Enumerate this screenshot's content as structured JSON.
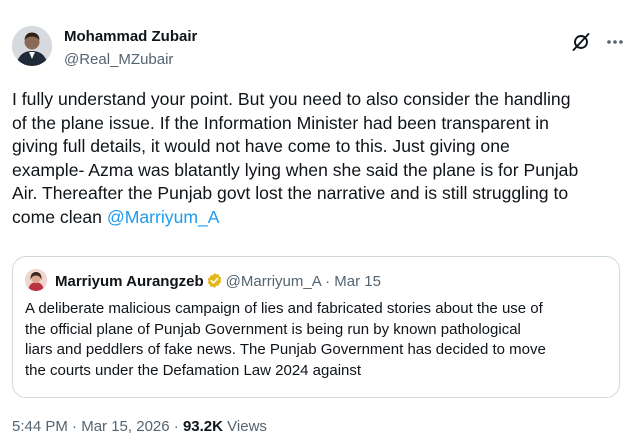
{
  "tweet": {
    "author_name": "Mohammad Zubair",
    "author_handle": "@Real_MZubair",
    "text": "I fully understand your point. But you need to also consider the handling\nof the plane issue. If the Information Minister had been transparent in\ngiving full details, it would not have come to this. Just giving one\nexample- Azma was blatantly lying when she said the plane is for Punjab\nAir. Thereafter the Punjab govt lost the narrative and is still struggling to\ncome clean ",
    "mention": "@Marriyum_A",
    "icons": {
      "grok": "grok-icon",
      "more": "more-icon",
      "verified": "verified-badge-icon"
    },
    "colors": {
      "link": "#1d9bf0",
      "verified_gold": "#e2b719",
      "muted": "#536471",
      "border": "#cfd9de"
    }
  },
  "quote": {
    "author_name": "Marriyum Aurangzeb",
    "handle": "@Marriyum_A",
    "separator": "·",
    "date": "Mar 15",
    "text": "A deliberate malicious campaign of lies and fabricated stories about the use of\nthe official plane of Punjab Government is being run by known pathological\nliars and  peddlers of fake news. The Punjab Government has decided to move\nthe courts under the Defamation Law 2024 against"
  },
  "footer": {
    "time": "5:44 PM",
    "separator": "·",
    "date": "Mar 15, 2026",
    "views_count": "93.2K",
    "views_label": "Views"
  }
}
